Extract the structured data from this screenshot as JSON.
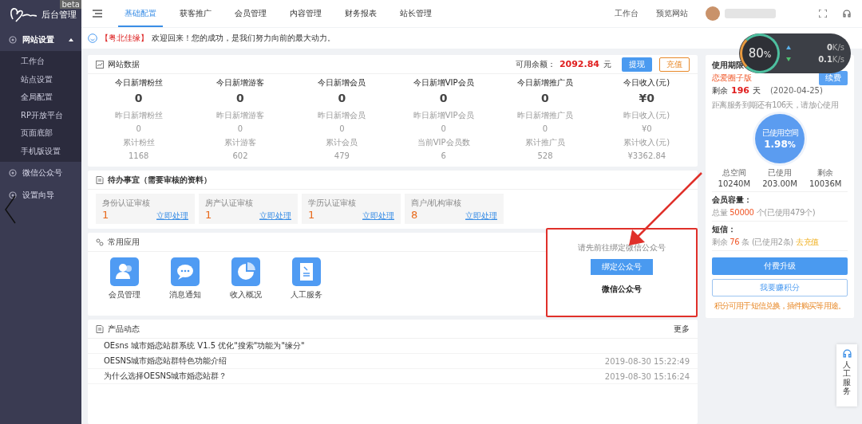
{
  "sidebar": {
    "logo": "后台管理",
    "badge": "beta",
    "groups": [
      {
        "label": "网站设置",
        "expanded": true,
        "children": [
          {
            "label": "工作台"
          },
          {
            "label": "站点设置"
          },
          {
            "label": "全局配置"
          },
          {
            "label": "RP开放平台"
          },
          {
            "label": "页面底部"
          },
          {
            "label": "手机版设置"
          }
        ]
      },
      {
        "label": "微信公众号",
        "expanded": false
      },
      {
        "label": "设置向导",
        "expanded": false
      }
    ]
  },
  "tabs": [
    {
      "label": "基础配置",
      "selected": true
    },
    {
      "label": "获客推广",
      "selected": false
    },
    {
      "label": "会员管理",
      "selected": false
    },
    {
      "label": "内容管理",
      "selected": false
    },
    {
      "label": "财务报表",
      "selected": false
    },
    {
      "label": "站长管理",
      "selected": false
    }
  ],
  "header_links": [
    "工作台",
    "预览网站"
  ],
  "notice": {
    "name": "【粤北佳缘】",
    "text": "欢迎回来！您的成功，是我们努力向前的最大动力。"
  },
  "network_widget": {
    "percent": "80",
    "unit": "%",
    "up": "0",
    "up_unit": "K/s",
    "down": "0.1",
    "down_unit": "K/s"
  },
  "site_data": {
    "title": "网站数据",
    "balance_label": "可用余额：",
    "balance": "2092.84",
    "balance_unit": "元",
    "buttons": [
      "提现",
      "充值"
    ],
    "stats": [
      {
        "title": "今日新增粉丝",
        "value": "0",
        "rows": [
          "昨日新增粉丝",
          "0",
          "累计粉丝",
          "1168"
        ]
      },
      {
        "title": "今日新增游客",
        "value": "0",
        "rows": [
          "昨日新增游客",
          "0",
          "累计游客",
          "602"
        ]
      },
      {
        "title": "今日新增会员",
        "value": "0",
        "rows": [
          "昨日新增会员",
          "0",
          "累计会员",
          "479"
        ]
      },
      {
        "title": "今日新增VIP会员",
        "value": "0",
        "rows": [
          "昨日新增VIP会员",
          "0",
          "当前VIP会员数",
          "6"
        ]
      },
      {
        "title": "今日新增推广员",
        "value": "0",
        "rows": [
          "昨日新增推广员",
          "0",
          "累计推广员",
          "528"
        ]
      },
      {
        "title": "今日收入(元)",
        "value": "¥0",
        "rows": [
          "昨日收入(元)",
          "¥0",
          "累计收入(元)",
          "¥3362.84"
        ]
      }
    ]
  },
  "todo": {
    "title": "待办事宜（需要审核的资料）",
    "items": [
      {
        "label": "身份认证审核",
        "count": "1",
        "link": "立即处理"
      },
      {
        "label": "房产认证审核",
        "count": "1",
        "link": "立即处理"
      },
      {
        "label": "学历认证审核",
        "count": "1",
        "link": "立即处理"
      },
      {
        "label": "商户/机构审核",
        "count": "8",
        "link": "立即处理"
      }
    ]
  },
  "apps": {
    "title": "常用应用",
    "items": [
      {
        "kind": "users",
        "label": "会员管理"
      },
      {
        "kind": "chat",
        "label": "消息通知"
      },
      {
        "kind": "pie",
        "label": "收入概况"
      },
      {
        "kind": "doc",
        "label": "人工服务"
      }
    ]
  },
  "wechat": {
    "hint": "请先前往绑定微信公众号",
    "button": "绑定公众号",
    "caption": "微信公众号"
  },
  "news": {
    "title": "产品动态",
    "more": "更多",
    "items": [
      {
        "title": "OEsns 城市婚恋站群系统 V1.5 优化\"搜索\"功能为\"缘分\""
      },
      {
        "title": "OESNS城市婚恋站群特色功能介绍",
        "date": "2019-08-30 15:22:49"
      },
      {
        "title": "为什么选择OESNS城市婚恋站群？",
        "date": "2019-08-30 15:16:24"
      }
    ]
  },
  "plan": {
    "title": "使用期限",
    "edition": "恋爱圈子版",
    "renew": "续费",
    "remain_label": "剩余",
    "remain": "196",
    "remain_unit": "天",
    "expiry": "(2020-04-25)",
    "note": "距离服务到期还有106天，请放心使用",
    "usage": {
      "label": "已使用空间",
      "value": "1.98",
      "unit": "%"
    },
    "space": [
      {
        "label": "总空间",
        "value": "10240M"
      },
      {
        "label": "已使用",
        "value": "203.00M"
      },
      {
        "label": "剩余",
        "value": "10036M"
      }
    ],
    "members": {
      "title": "会员容量：",
      "prefix": "总量",
      "value": "50000",
      "suffix": "个(已使用479个)"
    },
    "sms": {
      "title": "短信：",
      "prefix": "剩余",
      "value": "76",
      "suffix": "条 (已使用2条)",
      "link": "去充值"
    },
    "upgrade": "付费升级",
    "earn": "我要赚积分",
    "footnote": "积分可用于短信兑换，插件购买等用途。"
  },
  "service_tab": "人工服务"
}
